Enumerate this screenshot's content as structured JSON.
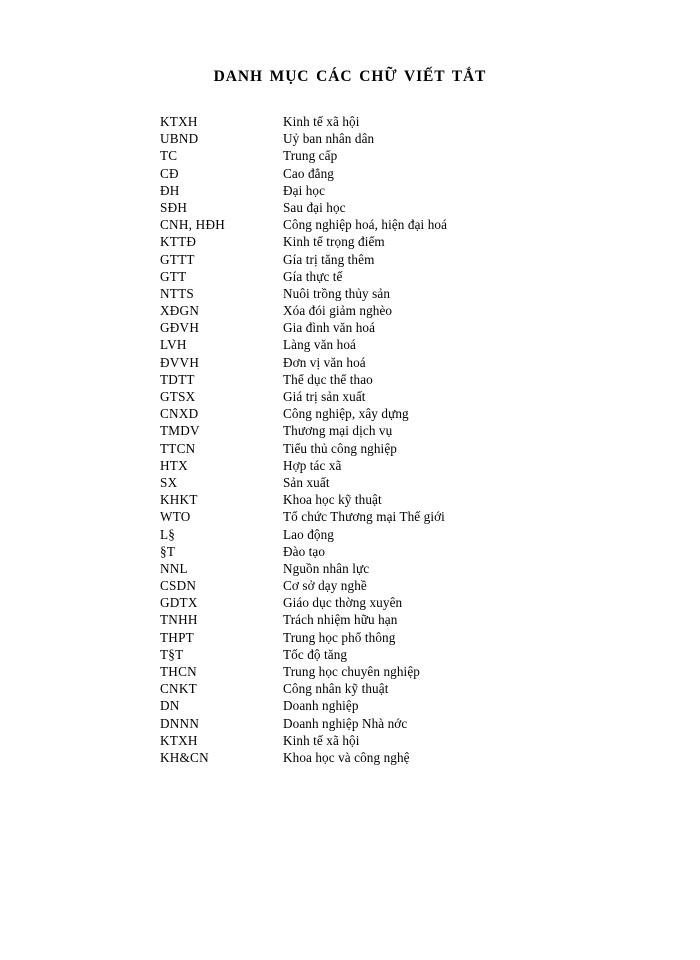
{
  "document": {
    "title": "DANH MỤC CÁC CHỮ VIẾT TẮT",
    "page_background": "#ffffff",
    "text_color": "#000000"
  },
  "abbreviations": [
    {
      "term": "KTXH",
      "definition": "Kinh tế xã hội"
    },
    {
      "term": "UBND",
      "definition": "Uỷ ban nhân dân"
    },
    {
      "term": "TC",
      "definition": "Trung  cấp"
    },
    {
      "term": "CĐ",
      "definition": "Cao đẳng"
    },
    {
      "term": "ĐH",
      "definition": "Đại học"
    },
    {
      "term": "SĐH",
      "definition": "Sau đại học"
    },
    {
      "term": "CNH, HĐH",
      "definition": "Công nghiệp  hoá, hiện đại hoá"
    },
    {
      "term": "KTTĐ",
      "definition": "Kinh tế trọng điểm"
    },
    {
      "term": "GTTT",
      "definition": "Gía trị tăng  thêm"
    },
    {
      "term": "GTT",
      "definition": "Gía thực tế"
    },
    {
      "term": "NTTS",
      "definition": "Nuôi trồng thủy sản"
    },
    {
      "term": "XĐGN",
      "definition": "Xóa đói giảm nghèo"
    },
    {
      "term": "GĐVH",
      "definition": "Gia đình văn hoá"
    },
    {
      "term": "LVH",
      "definition": "Làng  văn  hoá"
    },
    {
      "term": "ĐVVH",
      "definition": "Đơn vị văn hoá"
    },
    {
      "term": "TDTT",
      "definition": "Thể  dục thể thao"
    },
    {
      "term": "GTSX",
      "definition": "Giá trị sản xuất"
    },
    {
      "term": "CNXD",
      "definition": "Công nghiệp,  xây dựng"
    },
    {
      "term": "TMDV",
      "definition": "Thương  mại dịch vụ"
    },
    {
      "term": "TTCN",
      "definition": "Tiểu thủ công nghiệp"
    },
    {
      "term": "HTX",
      "definition": "Hợp tác xã"
    },
    {
      "term": "SX",
      "definition": "Sản xuất"
    },
    {
      "term": "KHKT",
      "definition": "Khoa học kỹ thuật"
    },
    {
      "term": "WTO",
      "definition": "Tổ chức Thương  mại Thế giới"
    },
    {
      "term": "L§",
      "definition": "Lao động"
    },
    {
      "term": "§T",
      "definition": "Đào tạo"
    },
    {
      "term": "NNL",
      "definition": "Nguồn nhân lực"
    },
    {
      "term": "CSDN",
      "definition": "Cơ sở dạy nghề"
    },
    {
      "term": "GDTX",
      "definition": "Giáo dục thờng   xuyên"
    },
    {
      "term": "TNHH",
      "definition": "Trách nhiệm hữu hạn"
    },
    {
      "term": "THPT",
      "definition": "Trung học phổ thông"
    },
    {
      "term": "T§T",
      "definition": "Tốc độ tăng"
    },
    {
      "term": "THCN",
      "definition": "Trung học chuyên nghiệp"
    },
    {
      "term": "CNKT",
      "definition": "Công nhân kỹ thuật"
    },
    {
      "term": "DN",
      "definition": "Doanh nghiệp"
    },
    {
      "term": "DNNN",
      "definition": "Doanh nghiệp Nhà nớc"
    },
    {
      "term": "KTXH",
      "definition": "Kinh tế xã hội"
    },
    {
      "term": "KH&CN",
      "definition": "Khoa học và công nghệ"
    }
  ]
}
